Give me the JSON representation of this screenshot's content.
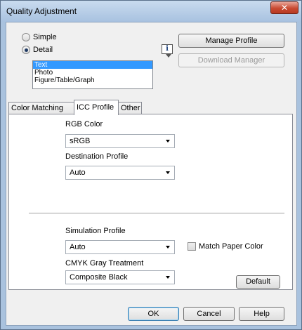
{
  "window": {
    "title": "Quality Adjustment",
    "close_glyph": "✕"
  },
  "mode": {
    "simple_label": "Simple",
    "detail_label": "Detail",
    "selected": "Detail"
  },
  "object_list": {
    "items": [
      "Text",
      "Photo",
      "Figure/Table/Graph"
    ],
    "selected": "Text"
  },
  "buttons": {
    "manage_profile": "Manage Profile",
    "download_manager": "Download Manager",
    "default": "Default",
    "ok": "OK",
    "cancel": "Cancel",
    "help": "Help"
  },
  "info_icon": {
    "name": "info-icon",
    "glyph": "i"
  },
  "tabs": [
    {
      "label": "Color Matching",
      "active": false
    },
    {
      "label": "ICC Profile",
      "active": true
    },
    {
      "label": "Other",
      "active": false
    }
  ],
  "icc": {
    "rgb_color_label": "RGB Color",
    "rgb_color_value": "sRGB",
    "destination_label": "Destination Profile",
    "destination_value": "Auto",
    "simulation_label": "Simulation Profile",
    "simulation_value": "Auto",
    "match_paper_label": "Match Paper Color",
    "match_paper_checked": false,
    "cmyk_gray_label": "CMYK Gray Treatment",
    "cmyk_gray_value": "Composite Black"
  },
  "colors": {
    "selection": "#3399ff",
    "frame": "#a9c2de",
    "close_red": "#c94a32"
  }
}
